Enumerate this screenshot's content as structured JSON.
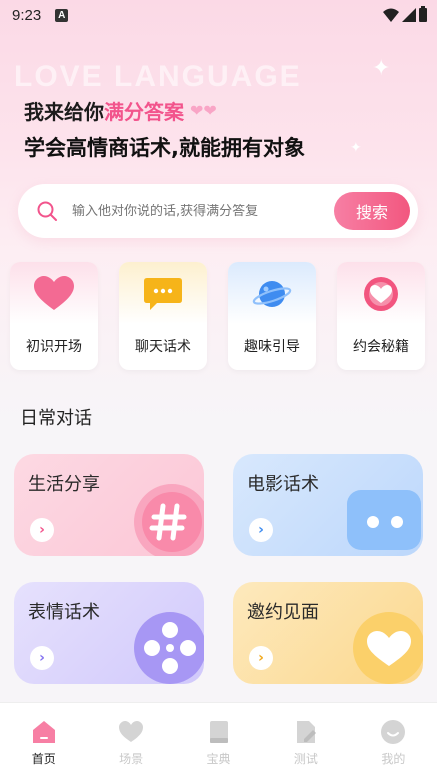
{
  "status_bar": {
    "time": "9:23",
    "badge": "A"
  },
  "hero": {
    "bg_text": "LOVE LANGUAGE",
    "headline_prefix": "我来给你",
    "headline_highlight": "满分答案",
    "headline_line2": "学会高情商话术,就能拥有对象"
  },
  "search": {
    "placeholder": "输入他对你说的话,获得满分答复",
    "button_label": "搜索"
  },
  "categories": [
    {
      "label": "初识开场",
      "icon": "heart-icon",
      "color": "#f36a93"
    },
    {
      "label": "聊天话术",
      "icon": "chat-bubble-icon",
      "color": "#f6b419"
    },
    {
      "label": "趣味引导",
      "icon": "planet-icon",
      "color": "#3f8cf0"
    },
    {
      "label": "约会秘籍",
      "icon": "heart-badge-icon",
      "color": "#f2557f"
    }
  ],
  "section_title": "日常对话",
  "cards": [
    {
      "title": "生活分享",
      "icon": "hashtag-icon",
      "bg": "#fcd2de"
    },
    {
      "title": "电影话术",
      "icon": "chat-dots-icon",
      "bg": "#c8dffd"
    },
    {
      "title": "表情话术",
      "icon": "film-reel-icon",
      "bg": "#dcd6fb"
    },
    {
      "title": "邀约见面",
      "icon": "heart-icon",
      "bg": "#fde2a4"
    }
  ],
  "tabs": [
    {
      "label": "首页",
      "icon": "home-icon",
      "active": true
    },
    {
      "label": "场景",
      "icon": "heart-icon",
      "active": false
    },
    {
      "label": "宝典",
      "icon": "book-icon",
      "active": false
    },
    {
      "label": "测试",
      "icon": "test-edit-icon",
      "active": false
    },
    {
      "label": "我的",
      "icon": "smiley-icon",
      "active": false
    }
  ],
  "colors": {
    "accent": "#f2548c",
    "search_button": "#f2577f"
  }
}
